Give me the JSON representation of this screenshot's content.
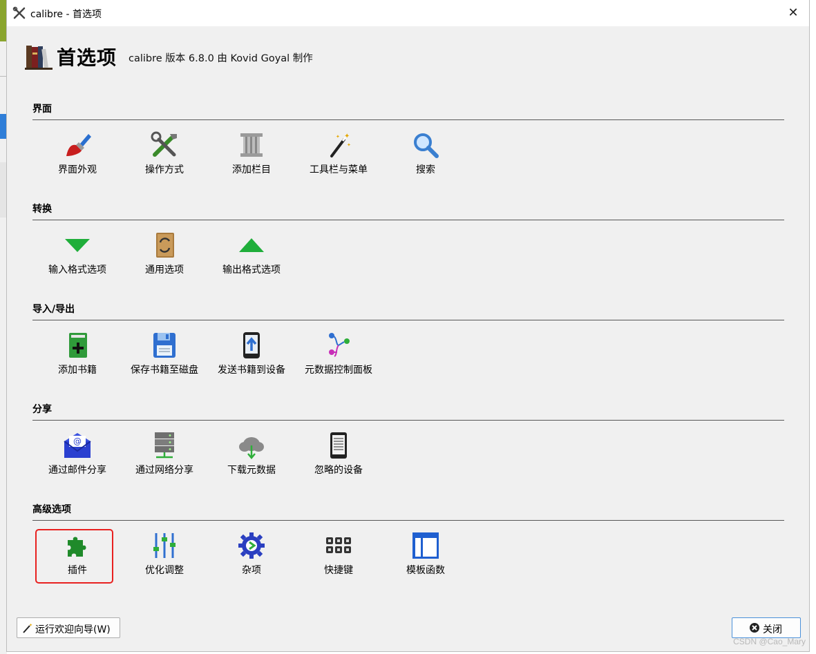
{
  "window": {
    "title": "calibre - 首选项",
    "close_glyph": "✕"
  },
  "header": {
    "title": "首选项",
    "subtitle": "calibre 版本 6.8.0 由 Kovid Goyal 制作"
  },
  "sections": [
    {
      "title": "界面",
      "items": [
        {
          "label": "界面外观",
          "icon": "paintbrush-icon"
        },
        {
          "label": "操作方式",
          "icon": "tools-icon"
        },
        {
          "label": "添加栏目",
          "icon": "column-icon"
        },
        {
          "label": "工具栏与菜单",
          "icon": "magic-wand-icon"
        },
        {
          "label": "搜索",
          "icon": "search-icon"
        }
      ]
    },
    {
      "title": "转换",
      "items": [
        {
          "label": "输入格式选项",
          "icon": "arrow-down-icon"
        },
        {
          "label": "通用选项",
          "icon": "book-convert-icon"
        },
        {
          "label": "输出格式选项",
          "icon": "arrow-up-icon"
        }
      ]
    },
    {
      "title": "导入/导出",
      "items": [
        {
          "label": "添加书籍",
          "icon": "add-book-icon"
        },
        {
          "label": "保存书籍至磁盘",
          "icon": "floppy-disk-icon"
        },
        {
          "label": "发送书籍到设备",
          "icon": "send-device-icon"
        },
        {
          "label": "元数据控制面板",
          "icon": "metadata-flow-icon"
        }
      ]
    },
    {
      "title": "分享",
      "items": [
        {
          "label": "通过邮件分享",
          "icon": "email-icon"
        },
        {
          "label": "通过网络分享",
          "icon": "server-icon"
        },
        {
          "label": "下载元数据",
          "icon": "cloud-download-icon"
        },
        {
          "label": "忽略的设备",
          "icon": "ereader-icon"
        }
      ]
    },
    {
      "title": "高级选项",
      "items": [
        {
          "label": "插件",
          "icon": "puzzle-piece-icon"
        },
        {
          "label": "优化调整",
          "icon": "sliders-icon"
        },
        {
          "label": "杂项",
          "icon": "gear-icon"
        },
        {
          "label": "快捷键",
          "icon": "keyboard-icon"
        },
        {
          "label": "模板函数",
          "icon": "template-icon"
        }
      ]
    }
  ],
  "footer": {
    "wizard_label": "运行欢迎向导(W)",
    "close_label": "关闭"
  },
  "watermark": "CSDN @Cao_Mary",
  "colors": {
    "highlight_border": "#e8201f",
    "window_bg": "#f0f0f0"
  }
}
